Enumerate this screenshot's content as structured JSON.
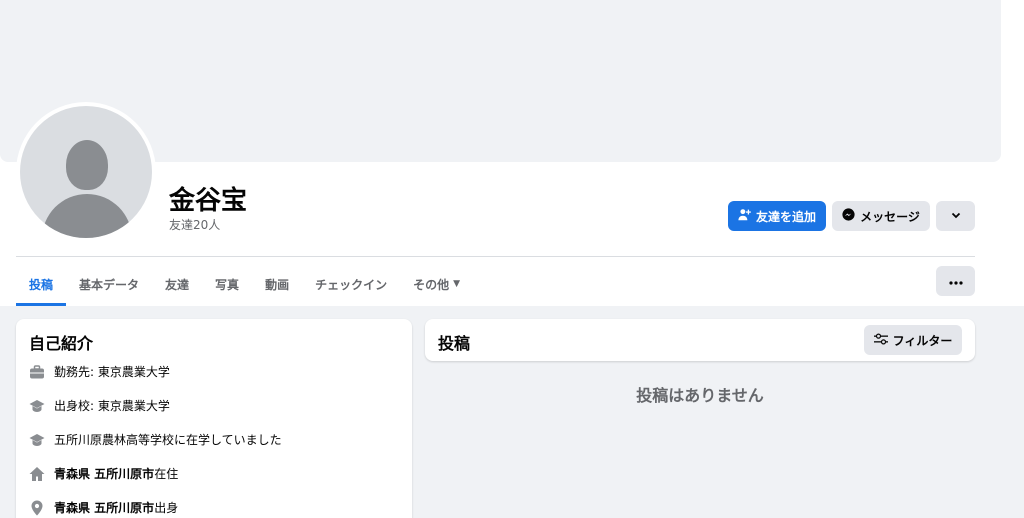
{
  "profile": {
    "name": "金谷宝",
    "friend_count": "友達20人"
  },
  "actions": {
    "add_friend": "友達を追加",
    "message": "メッセージ"
  },
  "tabs": [
    {
      "label": "投稿",
      "active": true
    },
    {
      "label": "基本データ"
    },
    {
      "label": "友達"
    },
    {
      "label": "写真"
    },
    {
      "label": "動画"
    },
    {
      "label": "チェックイン"
    },
    {
      "label": "その他"
    }
  ],
  "intro": {
    "title": "自己紹介",
    "items": [
      {
        "icon": "briefcase-icon",
        "text": "勤務先: 東京農業大学"
      },
      {
        "icon": "graduation-cap-icon",
        "text": "出身校: 東京農業大学"
      },
      {
        "icon": "graduation-cap-icon",
        "text": "五所川原農林高等学校に在学していました"
      },
      {
        "icon": "home-icon",
        "bold": "青森県 五所川原市",
        "text": "在住"
      },
      {
        "icon": "location-pin-icon",
        "bold": "青森県 五所川原市",
        "text": "出身"
      }
    ]
  },
  "posts": {
    "title": "投稿",
    "filter": "フィルター",
    "empty": "投稿はありません"
  },
  "colors": {
    "accent": "#1b74e4",
    "background": "#f0f2f5",
    "secondary_button": "#e4e6eb",
    "muted_text": "#65676b"
  }
}
